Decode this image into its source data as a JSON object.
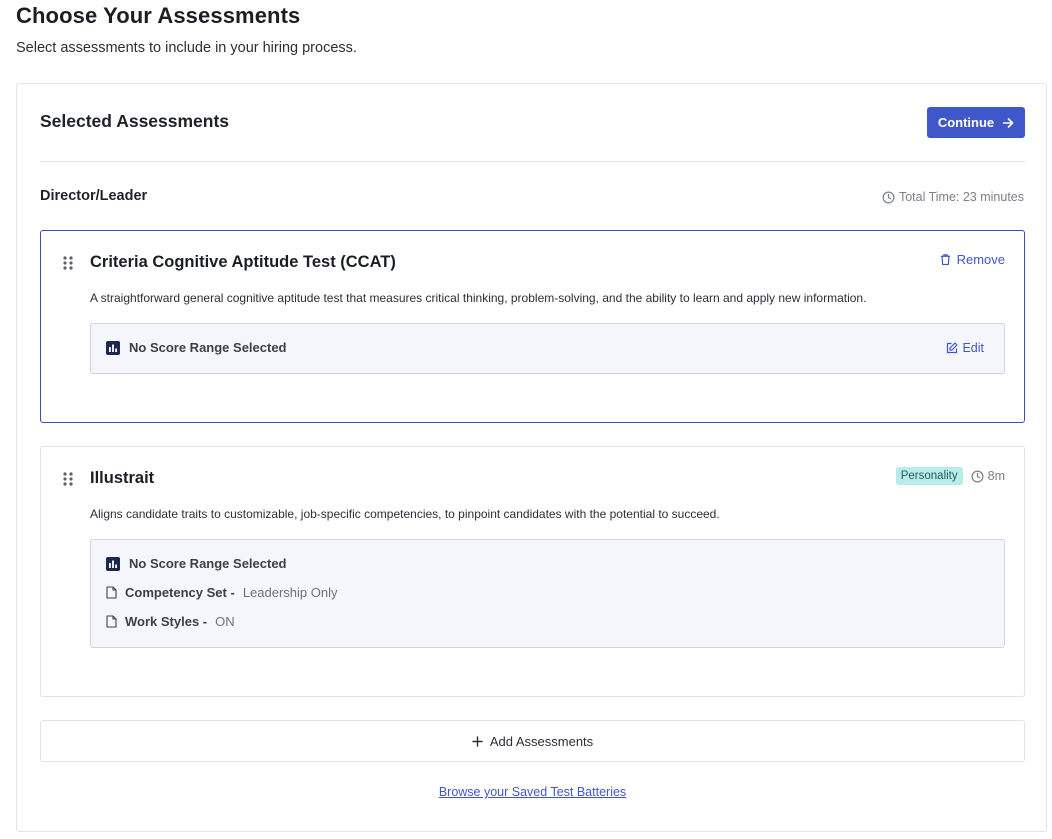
{
  "page": {
    "title": "Choose Your Assessments",
    "subtitle": "Select assessments to include in your hiring process."
  },
  "panel": {
    "title": "Selected Assessments",
    "continue_label": "Continue"
  },
  "group": {
    "name": "Director/Leader",
    "total_time": "Total Time: 23 minutes"
  },
  "assessments": [
    {
      "title": "Criteria Cognitive Aptitude Test (CCAT)",
      "description": "A straightforward general cognitive aptitude test that measures critical thinking, problem-solving, and the ability to learn and apply new information.",
      "remove_label": "Remove",
      "score_range": "No Score Range Selected",
      "edit_label": "Edit"
    },
    {
      "title": "Illustrait",
      "description": "Aligns candidate traits to customizable, job-specific competencies, to pinpoint candidates with the potential to succeed.",
      "badge": "Personality",
      "duration": "8m",
      "score_range": "No Score Range Selected",
      "competency_label": "Competency Set -",
      "competency_value": "Leadership Only",
      "workstyles_label": "Work Styles -",
      "workstyles_value": "ON"
    }
  ],
  "actions": {
    "add_label": "Add Assessments",
    "browse_label": "Browse your Saved Test Batteries"
  },
  "colors": {
    "accent": "#3f57c9",
    "badge_bg": "#b9ece9",
    "info_bg": "#f4f6fb"
  }
}
